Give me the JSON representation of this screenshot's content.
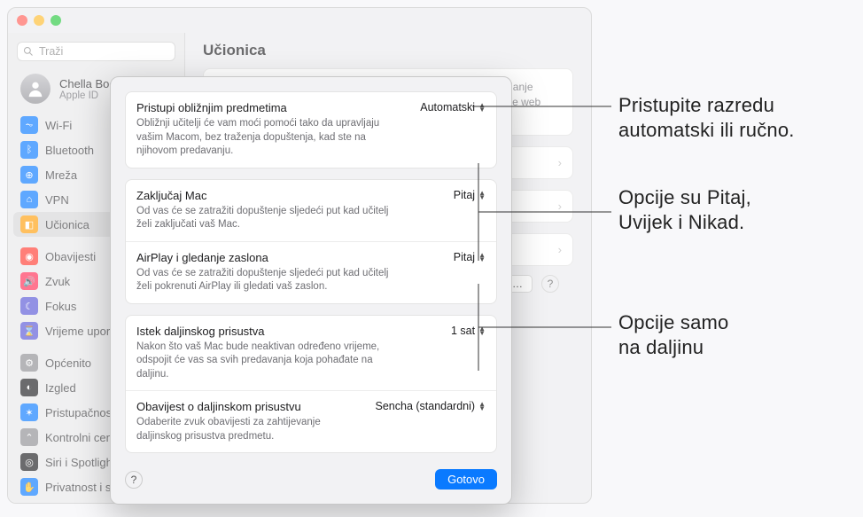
{
  "window": {
    "search_placeholder": "Traži",
    "user": {
      "name": "Chella Boe",
      "sub": "Apple ID"
    }
  },
  "sidebar": {
    "items": [
      {
        "label": "Wi-Fi",
        "color": "#0a7aff",
        "glyph": "⏦"
      },
      {
        "label": "Bluetooth",
        "color": "#0a7aff",
        "glyph": "ᛒ"
      },
      {
        "label": "Mreža",
        "color": "#0a7aff",
        "glyph": "⊕"
      },
      {
        "label": "VPN",
        "color": "#0a7aff",
        "glyph": "⌂"
      },
      {
        "label": "Učionica",
        "color": "#ff9f0a",
        "glyph": "◧",
        "selected": true
      },
      {
        "gap": true
      },
      {
        "label": "Obavijesti",
        "color": "#ff3b30",
        "glyph": "◉"
      },
      {
        "label": "Zvuk",
        "color": "#ff2d55",
        "glyph": "🔊"
      },
      {
        "label": "Fokus",
        "color": "#5856d6",
        "glyph": "☾"
      },
      {
        "label": "Vrijeme uporabe",
        "color": "#5856d6",
        "glyph": "⌛"
      },
      {
        "gap": true
      },
      {
        "label": "Općenito",
        "color": "#8e8e93",
        "glyph": "⚙"
      },
      {
        "label": "Izgled",
        "color": "#1d1d1f",
        "glyph": "◐"
      },
      {
        "label": "Pristupačnost",
        "color": "#0a7aff",
        "glyph": "✶"
      },
      {
        "label": "Kontrolni centar",
        "color": "#8e8e93",
        "glyph": "⌃"
      },
      {
        "label": "Siri i Spotlight",
        "color": "#1d1d1f",
        "glyph": "◎"
      },
      {
        "label": "Privatnost i sigurnost",
        "color": "#0a7aff",
        "glyph": "✋"
      }
    ]
  },
  "content": {
    "title": "Učionica",
    "banner": "Aplikacija Učionica omogućava učiteljima pristup i upravljanje vašim Macom, uključujući otvaranje aplikacija i navigiranje web stranicama,",
    "options_btn": "Opcije…"
  },
  "sheet": {
    "group1": [
      {
        "title": "Pristupi obližnjim predmetima",
        "desc": "Obližnji učitelji će vam moći pomoći tako da upravljaju vašim Macom, bez traženja dopuštenja, kad ste na njihovom predavanju.",
        "value": "Automatski"
      }
    ],
    "group2": [
      {
        "title": "Zaključaj Mac",
        "desc": "Od vas će se zatražiti dopuštenje sljedeći put kad učitelj želi zaključati vaš Mac.",
        "value": "Pitaj"
      },
      {
        "title": "AirPlay i gledanje zaslona",
        "desc": "Od vas će se zatražiti dopuštenje sljedeći put kad učitelj želi pokrenuti AirPlay ili gledati vaš zaslon.",
        "value": "Pitaj"
      }
    ],
    "group3": [
      {
        "title": "Istek daljinskog prisustva",
        "desc": "Nakon što vaš Mac bude neaktivan određeno vrijeme, odspojit će vas sa svih predavanja koja pohađate na daljinu.",
        "value": "1 sat"
      },
      {
        "title": "Obavijest o daljinskom prisustvu",
        "desc": "Odaberite zvuk obavijesti za zahtijevanje daljinskog prisustva predmetu.",
        "value": "Sencha (standardni)"
      }
    ],
    "done": "Gotovo"
  },
  "callouts": {
    "c1a": "Pristupite razredu",
    "c1b": "automatski ili ručno.",
    "c2a": "Opcije su Pitaj,",
    "c2b": "Uvijek i Nikad.",
    "c3a": "Opcije samo",
    "c3b": "na daljinu"
  }
}
